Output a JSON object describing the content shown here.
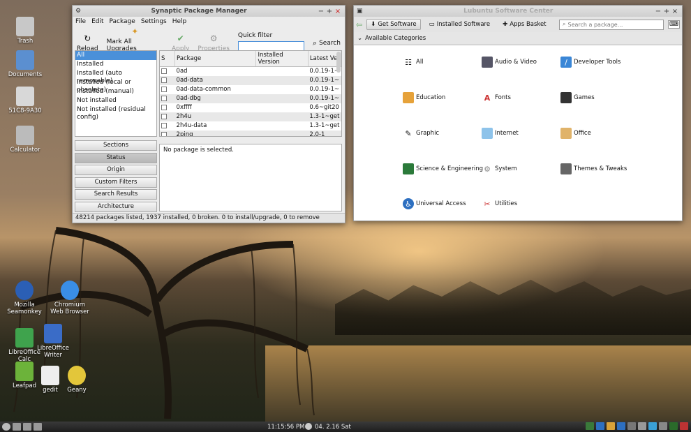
{
  "desktop": {
    "icons": [
      {
        "label": "Trash",
        "icon": "trash-icon"
      },
      {
        "label": "Documents",
        "icon": "folder-icon"
      },
      {
        "label": "51C8-9A30",
        "icon": "drive-icon"
      },
      {
        "label": "Calculator",
        "icon": "calculator-icon"
      },
      {
        "label": "Mozilla Seamonkey",
        "icon": "seamonkey-icon"
      },
      {
        "label": "Chromium Web Browser",
        "icon": "chromium-icon"
      },
      {
        "label": "LibreOffice Calc",
        "icon": "calc-icon"
      },
      {
        "label": "LibreOffice Writer",
        "icon": "writer-icon"
      },
      {
        "label": "Leafpad",
        "icon": "leafpad-icon"
      },
      {
        "label": "gedit",
        "icon": "gedit-icon"
      },
      {
        "label": "Geany",
        "icon": "geany-icon"
      }
    ]
  },
  "synaptic": {
    "title": "Synaptic Package Manager",
    "menu": [
      "File",
      "Edit",
      "Package",
      "Settings",
      "Help"
    ],
    "toolbar": {
      "reload": "Reload",
      "mark_all": "Mark All Upgrades",
      "apply": "Apply",
      "properties": "Properties",
      "quick_filter": "Quick filter",
      "search": "Search"
    },
    "filters": [
      "All",
      "Installed",
      "Installed (auto removable)",
      "Installed (local or obsolete)",
      "Installed (manual)",
      "Not installed",
      "Not installed (residual config)"
    ],
    "side_buttons": [
      "Sections",
      "Status",
      "Origin",
      "Custom Filters",
      "Search Results",
      "Architecture"
    ],
    "columns": [
      "S",
      "Package",
      "Installed Version",
      "Latest Ve"
    ],
    "packages": [
      {
        "name": "0ad",
        "installed": "",
        "latest": "0.0.19-1~"
      },
      {
        "name": "0ad-data",
        "installed": "",
        "latest": "0.0.19-1~"
      },
      {
        "name": "0ad-data-common",
        "installed": "",
        "latest": "0.0.19-1~"
      },
      {
        "name": "0ad-dbg",
        "installed": "",
        "latest": "0.0.19-1~"
      },
      {
        "name": "0xffff",
        "installed": "",
        "latest": "0.6~git20"
      },
      {
        "name": "2h4u",
        "installed": "",
        "latest": "1.3-1~get"
      },
      {
        "name": "2h4u-data",
        "installed": "",
        "latest": "1.3-1~get"
      },
      {
        "name": "2ping",
        "installed": "",
        "latest": "2.0-1"
      }
    ],
    "detail": "No package is selected.",
    "status": "48214 packages listed, 1937 installed, 0 broken. 0 to install/upgrade, 0 to remove"
  },
  "software_center": {
    "title": "Lubuntu Software Center",
    "tabs": {
      "get": "Get Software",
      "installed": "Installed Software",
      "basket": "Apps Basket"
    },
    "search_placeholder": "Search a package...",
    "categories_header": "Available Categories",
    "categories": [
      {
        "label": "All",
        "icon": "all-icon"
      },
      {
        "label": "Audio & Video",
        "icon": "audio-video-icon"
      },
      {
        "label": "Developer Tools",
        "icon": "developer-tools-icon"
      },
      {
        "label": "Education",
        "icon": "education-icon"
      },
      {
        "label": "Fonts",
        "icon": "fonts-icon"
      },
      {
        "label": "Games",
        "icon": "games-icon"
      },
      {
        "label": "Graphic",
        "icon": "graphic-icon"
      },
      {
        "label": "Internet",
        "icon": "internet-icon"
      },
      {
        "label": "Office",
        "icon": "office-icon"
      },
      {
        "label": "Science & Engineering",
        "icon": "science-icon"
      },
      {
        "label": "System",
        "icon": "system-icon"
      },
      {
        "label": "Themes & Tweaks",
        "icon": "themes-icon"
      },
      {
        "label": "Universal Access",
        "icon": "universal-access-icon"
      },
      {
        "label": "Utilities",
        "icon": "utilities-icon"
      }
    ]
  },
  "taskbar": {
    "time": "11:15:56 PM",
    "date": "04. 2.16 Sat"
  },
  "colors": {
    "selection": "#4a90d9",
    "taskbar": "#2a2a2a",
    "window_bg": "#ececec"
  }
}
